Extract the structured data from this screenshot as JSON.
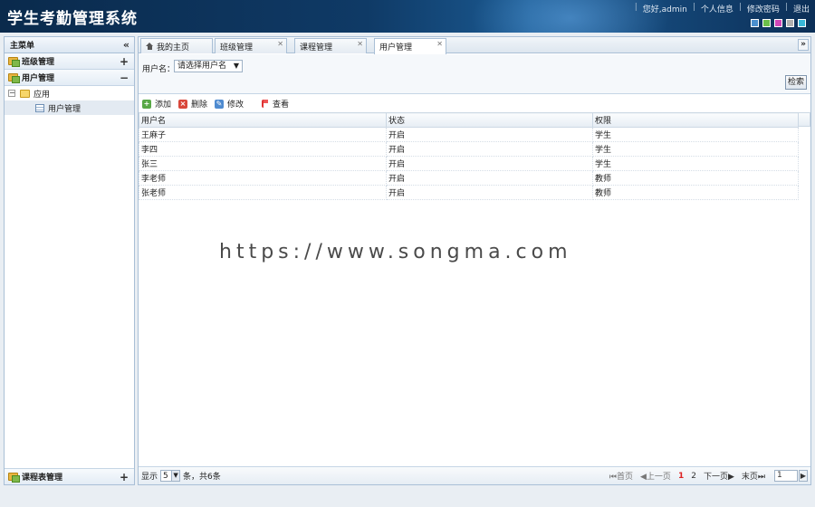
{
  "header": {
    "title": "学生考勤管理系统",
    "links": [
      "您好,admin",
      "个人信息",
      "修改密码",
      "退出"
    ],
    "themes": [
      "#4a8fcf",
      "#6cbf4a",
      "#d046b8",
      "#b0b0b0",
      "#39b7d8"
    ]
  },
  "sidebar": {
    "title": "主菜单",
    "sections": [
      {
        "label": "班级管理",
        "toggle": "+"
      },
      {
        "label": "用户管理",
        "toggle": "−"
      }
    ],
    "tree": {
      "parent": "应用",
      "child": "用户管理"
    },
    "bottom_section": {
      "label": "课程表管理",
      "toggle": "+"
    }
  },
  "tabs": [
    {
      "label": "我的主页"
    },
    {
      "label": "班级管理"
    },
    {
      "label": "课程管理"
    },
    {
      "label": "用户管理"
    }
  ],
  "search": {
    "label": "用户名：",
    "select_value": "请选择用户名",
    "button": "检索"
  },
  "toolbar": {
    "add": "添加",
    "delete": "删除",
    "edit": "修改",
    "view": "查看"
  },
  "grid": {
    "columns": [
      "用户名",
      "状态",
      "权限"
    ],
    "rows": [
      [
        "王麻子",
        "开启",
        "学生"
      ],
      [
        "李四",
        "开启",
        "学生"
      ],
      [
        "张三",
        "开启",
        "学生"
      ],
      [
        "李老师",
        "开启",
        "教师"
      ],
      [
        "张老师",
        "开启",
        "教师"
      ]
    ]
  },
  "watermark": "https://www.songma.com",
  "pager": {
    "show": "显示",
    "page_size": "5",
    "summary": "条，共6条",
    "first": "首页",
    "prev": "上一页",
    "page1": "1",
    "page2": "2",
    "next": "下一页",
    "last": "末页",
    "current": "1"
  }
}
